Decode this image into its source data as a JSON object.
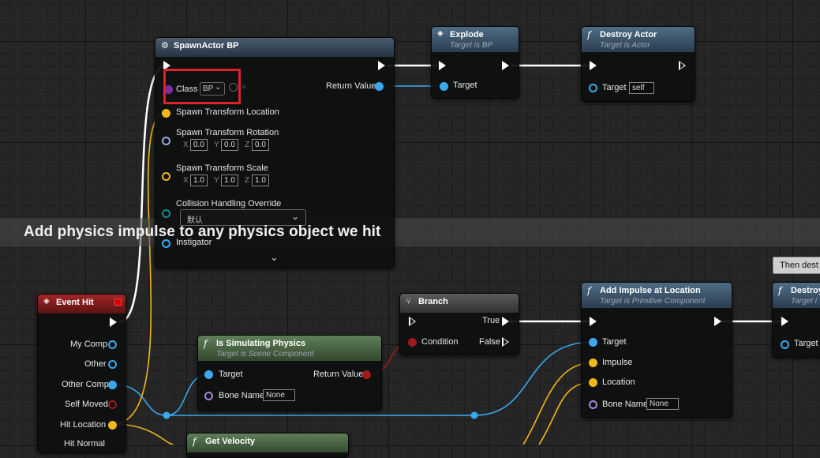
{
  "comment": "Add physics impulse to any physics object we hit",
  "tooltip": "Then dest",
  "spawn_node": {
    "title": "SpawnActor BP",
    "class_label": "Class",
    "class_value": "BP",
    "return_value": "Return Value",
    "spawn_location": "Spawn Transform Location",
    "spawn_rotation": "Spawn Transform Rotation",
    "rot": [
      "0.0",
      "0.0",
      "0.0"
    ],
    "spawn_scale": "Spawn Transform Scale",
    "scale": [
      "1.0",
      "1.0",
      "1.0"
    ],
    "axes": [
      "X",
      "Y",
      "Z"
    ],
    "collision": "Collision Handling Override",
    "collision_value": "默认",
    "instigator": "Instigator"
  },
  "explode_node": {
    "title": "Explode",
    "subtitle": "Target is BP",
    "target": "Target"
  },
  "destroy_node": {
    "title": "Destroy Actor",
    "subtitle": "Target is Actor",
    "target": "Target",
    "target_value": "self"
  },
  "event_hit": {
    "title": "Event Hit",
    "pins": [
      "My Comp",
      "Other",
      "Other Comp",
      "Self Moved",
      "Hit Location",
      "Hit Normal"
    ]
  },
  "is_sim": {
    "title": "Is Simulating Physics",
    "subtitle": "Target is Scene Component",
    "target": "Target",
    "bone": "Bone Name",
    "bone_value": "None",
    "return": "Return Value"
  },
  "branch": {
    "title": "Branch",
    "condition": "Condition",
    "true_label": "True",
    "false_label": "False"
  },
  "impulse": {
    "title": "Add Impulse at Location",
    "subtitle": "Target is Primitive Component",
    "target": "Target",
    "impulse": "Impulse",
    "location": "Location",
    "bone": "Bone Name",
    "bone_value": "None"
  },
  "destroy2": {
    "title": "Destroy",
    "subtitle": "Target i",
    "target": "Target"
  },
  "velocity": {
    "title": "Get Velocity"
  }
}
